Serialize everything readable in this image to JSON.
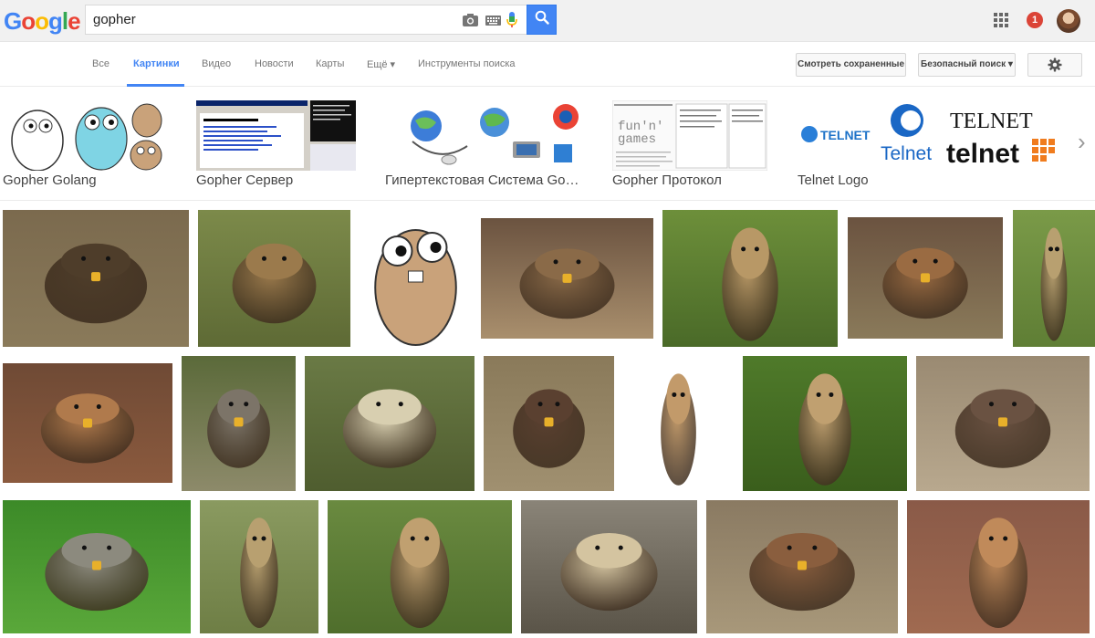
{
  "logo": {
    "letters": [
      "G",
      "o",
      "o",
      "g",
      "l",
      "e"
    ],
    "colors": [
      "#4285f4",
      "#ea4335",
      "#fbbc05",
      "#4285f4",
      "#34a853",
      "#ea4335"
    ]
  },
  "search": {
    "value": "gopher"
  },
  "header": {
    "notifications": "1"
  },
  "nav": {
    "tabs": [
      {
        "label": "Все",
        "active": false
      },
      {
        "label": "Картинки",
        "active": true
      },
      {
        "label": "Видео",
        "active": false
      },
      {
        "label": "Новости",
        "active": false
      },
      {
        "label": "Карты",
        "active": false
      },
      {
        "label": "Ещё ▾",
        "active": false
      },
      {
        "label": "Инструменты поиска",
        "active": false
      }
    ],
    "saved_label": "Смотреть сохраненные",
    "safe_search_label": "Безопасный поиск ▾"
  },
  "related": [
    {
      "label": "Gopher Golang"
    },
    {
      "label": "Gopher Сервер"
    },
    {
      "label": "Гипертекстовая Система Go…"
    },
    {
      "label": "Gopher Протокол"
    },
    {
      "label": "Telnet Logo"
    }
  ],
  "colors": {
    "accent": "#4285f4",
    "badge": "#db4437"
  }
}
